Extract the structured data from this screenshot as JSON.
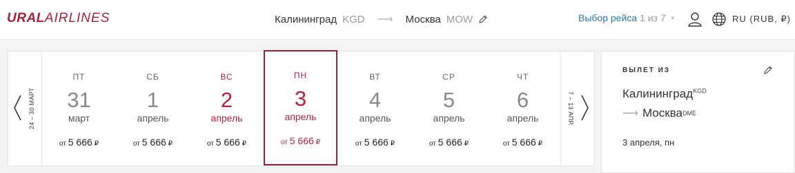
{
  "brand": {
    "part1": "URAL",
    "part2": "AIRLINES",
    "color": "#a8203a"
  },
  "route": {
    "origin_city": "Калининград",
    "origin_code": "KGD",
    "arrow": "⟶",
    "dest_city": "Москва",
    "dest_code": "MOW"
  },
  "flight_select": {
    "label": "Выбор рейса",
    "count": "1 из 7",
    "caret": "▼"
  },
  "locale": {
    "label": "RU (RUB, ₽)"
  },
  "calendar": {
    "prev_range": "24 – 30 МАРТ",
    "next_range": "7 – 13 АПР.",
    "days": [
      {
        "dow": "ПТ",
        "num": "31",
        "month": "март",
        "from": "от",
        "price": "5 666",
        "currency": "₽"
      },
      {
        "dow": "СБ",
        "num": "1",
        "month": "апрель",
        "from": "от",
        "price": "5 666",
        "currency": "₽"
      },
      {
        "dow": "ВС",
        "num": "2",
        "month": "апрель",
        "from": "от",
        "price": "5 666",
        "currency": "₽"
      },
      {
        "dow": "ПН",
        "num": "3",
        "month": "апрель",
        "from": "от",
        "price": "5 666",
        "currency": "₽"
      },
      {
        "dow": "ВТ",
        "num": "4",
        "month": "апрель",
        "from": "от",
        "price": "5 666",
        "currency": "₽"
      },
      {
        "dow": "СР",
        "num": "5",
        "month": "апрель",
        "from": "от",
        "price": "5 666",
        "currency": "₽"
      },
      {
        "dow": "ЧТ",
        "num": "6",
        "month": "апрель",
        "from": "от",
        "price": "5 666",
        "currency": "₽"
      }
    ]
  },
  "summary": {
    "title": "ВЫЛЕТ ИЗ",
    "origin_city": "Калининград",
    "origin_code": "KGD",
    "arrow": "⟶",
    "dest_city": "Москва",
    "dest_code": "DME",
    "date": "3 апреля, пн"
  },
  "colors": {
    "accent": "#b3213d",
    "link": "#2a7ab0"
  }
}
